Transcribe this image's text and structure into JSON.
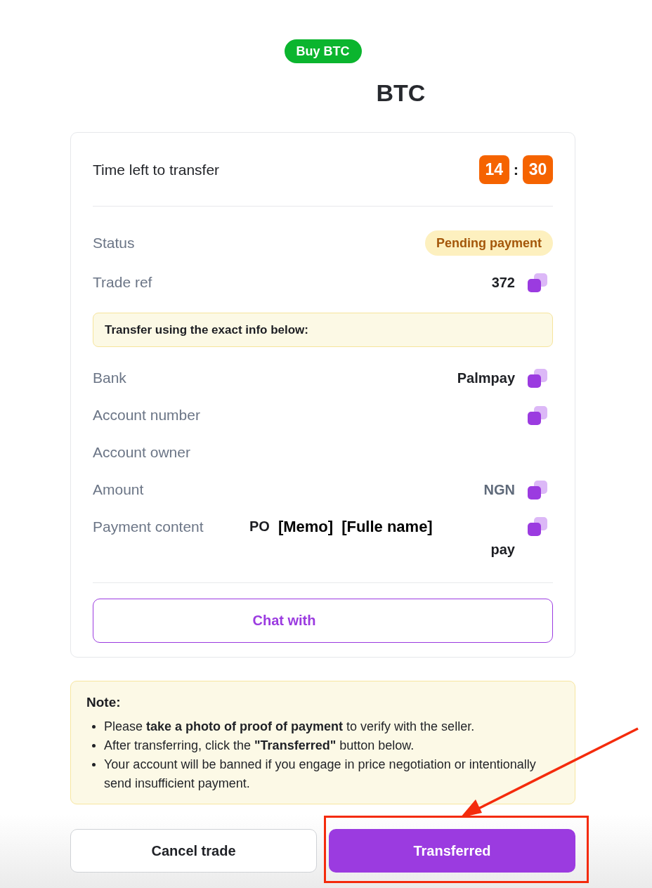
{
  "header": {
    "badge": "Buy BTC",
    "title": "BTC"
  },
  "timer": {
    "label": "Time left to transfer",
    "minutes": "14",
    "separator": ":",
    "seconds": "30"
  },
  "details": [
    {
      "kind": "status",
      "label": "Status",
      "value": "Pending payment"
    },
    {
      "kind": "copy",
      "label": "Trade ref",
      "value": "372",
      "muted": false
    },
    {
      "kind": "notice",
      "text": "Transfer using the exact info below:"
    },
    {
      "kind": "copy",
      "label": "Bank",
      "value": "Palmpay",
      "muted": false
    },
    {
      "kind": "copy",
      "label": "Account number"
    },
    {
      "kind": "plain",
      "label": "Account owner"
    },
    {
      "kind": "copy",
      "label": "Amount",
      "value": "NGN",
      "muted": true
    },
    {
      "kind": "memo",
      "label": "Payment content",
      "parts": [
        {
          "kind": "text",
          "text": "PO"
        },
        {
          "kind": "placeholder",
          "text": "[Memo]"
        },
        {
          "kind": "placeholder",
          "text": "[Fulle name]"
        }
      ],
      "tail": "pay"
    }
  ],
  "chat_button": "Chat with",
  "note": {
    "title": "Note:",
    "items": [
      "Please **take a photo of proof of payment** to verify with the seller.",
      "After transferring, click the **\"Transferred\"** button below.",
      "Your account will be banned if you engage in price negotiation or intentionally send insufficient payment."
    ]
  },
  "actions": [
    {
      "kind": "secondary",
      "label": "Cancel trade",
      "highlighted": false
    },
    {
      "kind": "primary",
      "label": "Transferred",
      "highlighted": true
    }
  ],
  "annotations": [
    {
      "kind": "arrow"
    }
  ]
}
